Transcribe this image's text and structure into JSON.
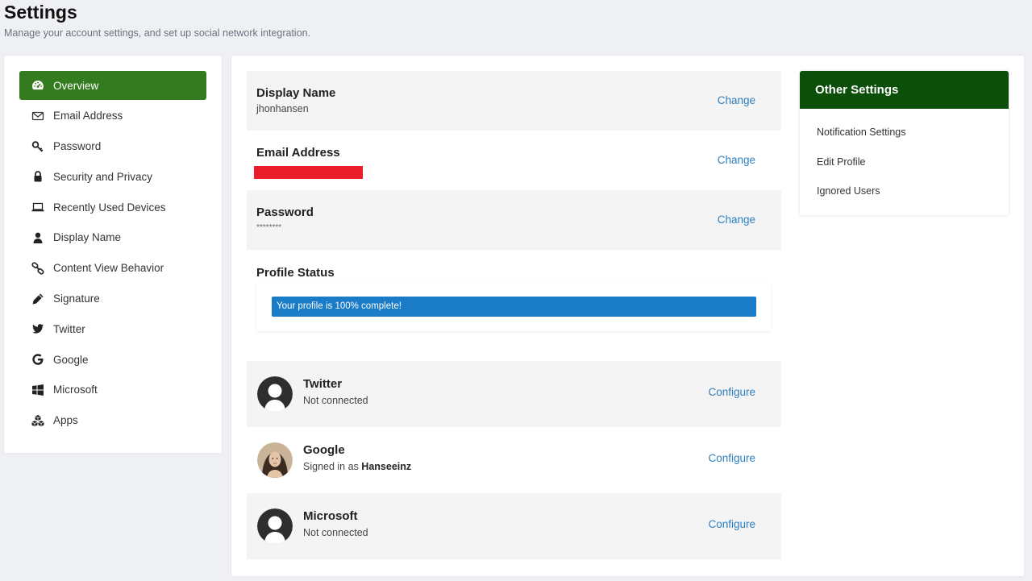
{
  "header": {
    "title": "Settings",
    "subtitle": "Manage your account settings, and set up social network integration."
  },
  "nav": {
    "items": [
      {
        "label": "Overview",
        "icon": "dashboard-icon",
        "active": true
      },
      {
        "label": "Email Address",
        "icon": "envelope-icon"
      },
      {
        "label": "Password",
        "icon": "key-icon"
      },
      {
        "label": "Security and Privacy",
        "icon": "lock-icon"
      },
      {
        "label": "Recently Used Devices",
        "icon": "laptop-icon"
      },
      {
        "label": "Display Name",
        "icon": "user-icon"
      },
      {
        "label": "Content View Behavior",
        "icon": "link-icon"
      },
      {
        "label": "Signature",
        "icon": "pencil-icon"
      },
      {
        "label": "Twitter",
        "icon": "twitter-icon"
      },
      {
        "label": "Google",
        "icon": "google-icon"
      },
      {
        "label": "Microsoft",
        "icon": "windows-icon"
      },
      {
        "label": "Apps",
        "icon": "cubes-icon"
      }
    ]
  },
  "account": {
    "display_name": {
      "title": "Display Name",
      "value": "jhonhansen",
      "action": "Change"
    },
    "email": {
      "title": "Email Address",
      "action": "Change"
    },
    "password": {
      "title": "Password",
      "value": "********",
      "action": "Change"
    }
  },
  "profile_status": {
    "title": "Profile Status",
    "progress_text": "Your profile is 100% complete!",
    "progress_percent": 100
  },
  "social": {
    "twitter": {
      "title": "Twitter",
      "status": "Not connected",
      "action": "Configure"
    },
    "google": {
      "title": "Google",
      "status_prefix": "Signed in as",
      "username": "Hanseeinz",
      "action": "Configure"
    },
    "microsoft": {
      "title": "Microsoft",
      "status": "Not connected",
      "action": "Configure"
    }
  },
  "other_settings": {
    "title": "Other Settings",
    "links": [
      "Notification Settings",
      "Edit Profile",
      "Ignored Users"
    ]
  },
  "colors": {
    "nav_active": "#347a1e",
    "other_header": "#0c4f0a",
    "link": "#2d7fbf",
    "progress": "#1a7bc7",
    "redaction": "#ea1d2b"
  }
}
